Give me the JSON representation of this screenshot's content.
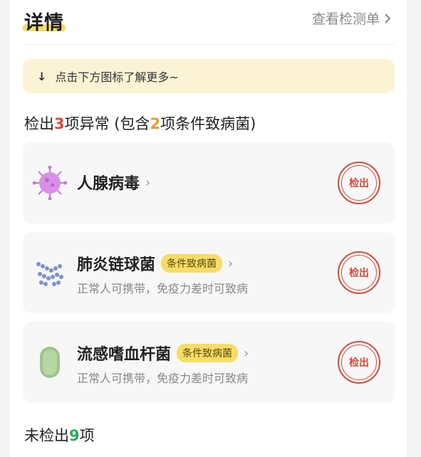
{
  "header": {
    "title": "详情",
    "view_link": "查看检测单"
  },
  "tip": {
    "text": "点击下方图标了解更多~"
  },
  "summary": {
    "prefix": "检出",
    "detected_count": "3",
    "middle": "项异常 (包含",
    "conditional_count": "2",
    "suffix": "项条件致病菌)"
  },
  "items": [
    {
      "name": "人腺病毒",
      "badge": "",
      "desc": "",
      "stamp": "检出",
      "icon": "virus-icon"
    },
    {
      "name": "肺炎链球菌",
      "badge": "条件致病菌",
      "desc": "正常人可携带，免疫力差时可致病",
      "stamp": "检出",
      "icon": "streptococcus-icon"
    },
    {
      "name": "流感嗜血杆菌",
      "badge": "条件致病菌",
      "desc": "正常人可携带，免疫力差时可致病",
      "stamp": "检出",
      "icon": "bacillus-icon"
    }
  ],
  "undetected": {
    "prefix": "未检出",
    "count": "9",
    "suffix": "项"
  },
  "colors": {
    "accent_yellow": "#f7dc66",
    "detected_red": "#e0483a",
    "conditional_orange": "#e69a2e",
    "undetected_green": "#2eaa55"
  }
}
